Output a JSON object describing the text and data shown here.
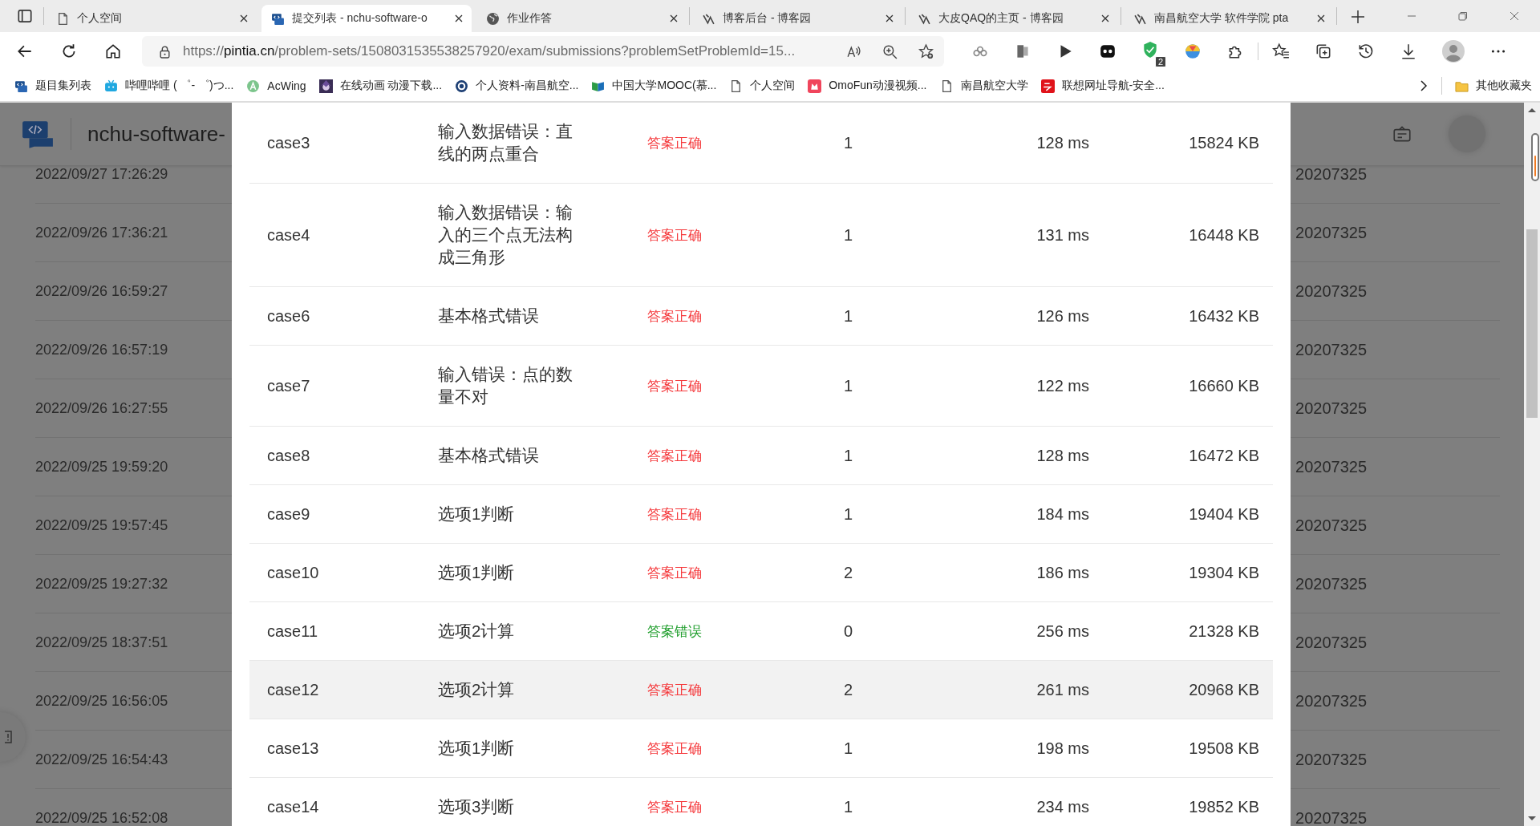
{
  "tabs": [
    {
      "title": "个人空间",
      "kind": "page",
      "selected": false
    },
    {
      "title": "提交列表 - nchu-software-o",
      "kind": "pta",
      "selected": true
    },
    {
      "title": "作业作答",
      "kind": "globe",
      "selected": false
    },
    {
      "title": "博客后台 - 博客园",
      "kind": "cnblogs",
      "selected": false
    },
    {
      "title": "大皮QAQ的主页 - 博客园",
      "kind": "cnblogs",
      "selected": false
    },
    {
      "title": "南昌航空大学 软件学院 pta",
      "kind": "cnblogs",
      "selected": false
    }
  ],
  "address": {
    "scheme": "https://",
    "host": "pintia.cn",
    "path": "/problem-sets/1508031535538257920/exam/submissions?problemSetProblemId=15..."
  },
  "extension_badge": "2",
  "bookmarks": [
    {
      "label": "题目集列表",
      "kind": "pta"
    },
    {
      "label": "哔哩哔哩 ( ゜- ゜)つ...",
      "kind": "tv"
    },
    {
      "label": "AcWing",
      "kind": "acwing"
    },
    {
      "label": "在线动画 动漫下载...",
      "kind": "anime"
    },
    {
      "label": "个人资料-南昌航空...",
      "kind": "seal"
    },
    {
      "label": "中国大学MOOC(慕...",
      "kind": "book"
    },
    {
      "label": "个人空间",
      "kind": "page"
    },
    {
      "label": "OmoFun动漫视频...",
      "kind": "omo"
    },
    {
      "label": "南昌航空大学",
      "kind": "page"
    },
    {
      "label": "联想网址导航-安全...",
      "kind": "lenovo"
    }
  ],
  "other_bookmarks": "其他收藏夹",
  "site_title": "nchu-software-",
  "background_rows": [
    {
      "time": "2022/09/27 17:26:29",
      "user": "20207325"
    },
    {
      "time": "2022/09/26 17:36:21",
      "user": "20207325"
    },
    {
      "time": "2022/09/26 16:59:27",
      "user": "20207325"
    },
    {
      "time": "2022/09/26 16:57:19",
      "user": "20207325"
    },
    {
      "time": "2022/09/26 16:27:55",
      "user": "20207325"
    },
    {
      "time": "2022/09/25 19:59:20",
      "user": "20207325"
    },
    {
      "time": "2022/09/25 19:57:45",
      "user": "20207325"
    },
    {
      "time": "2022/09/25 19:27:32",
      "user": "20207325"
    },
    {
      "time": "2022/09/25 18:37:51",
      "user": "20207325"
    },
    {
      "time": "2022/09/25 16:56:05",
      "user": "20207325"
    },
    {
      "time": "2022/09/25 16:54:43",
      "user": "20207325"
    },
    {
      "time": "2022/09/25 16:52:08",
      "user": "20207325"
    }
  ],
  "cases": [
    {
      "case": "case3",
      "description": "输入数据错误：直线的两点重合",
      "result": "答案正确",
      "color": "#f5383b",
      "score": "1",
      "time": "128 ms",
      "memory": "15824 KB",
      "highlighted": false
    },
    {
      "case": "case4",
      "description": "输入数据错误：输入的三个点无法构成三角形",
      "result": "答案正确",
      "color": "#f5383b",
      "score": "1",
      "time": "131 ms",
      "memory": "16448 KB",
      "highlighted": false
    },
    {
      "case": "case6",
      "description": "基本格式错误",
      "result": "答案正确",
      "color": "#f5383b",
      "score": "1",
      "time": "126 ms",
      "memory": "16432 KB",
      "highlighted": false
    },
    {
      "case": "case7",
      "description": "输入错误：点的数量不对",
      "result": "答案正确",
      "color": "#f5383b",
      "score": "1",
      "time": "122 ms",
      "memory": "16660 KB",
      "highlighted": false
    },
    {
      "case": "case8",
      "description": "基本格式错误",
      "result": "答案正确",
      "color": "#f5383b",
      "score": "1",
      "time": "128 ms",
      "memory": "16472 KB",
      "highlighted": false
    },
    {
      "case": "case9",
      "description": "选项1判断",
      "result": "答案正确",
      "color": "#f5383b",
      "score": "1",
      "time": "184 ms",
      "memory": "19404 KB",
      "highlighted": false
    },
    {
      "case": "case10",
      "description": "选项1判断",
      "result": "答案正确",
      "color": "#f5383b",
      "score": "2",
      "time": "186 ms",
      "memory": "19304 KB",
      "highlighted": false
    },
    {
      "case": "case11",
      "description": "选项2计算",
      "result": "答案错误",
      "color": "#1f9e2c",
      "score": "0",
      "time": "256 ms",
      "memory": "21328 KB",
      "highlighted": false
    },
    {
      "case": "case12",
      "description": "选项2计算",
      "result": "答案正确",
      "color": "#f5383b",
      "score": "2",
      "time": "261 ms",
      "memory": "20968 KB",
      "highlighted": true
    },
    {
      "case": "case13",
      "description": "选项1判断",
      "result": "答案正确",
      "color": "#f5383b",
      "score": "1",
      "time": "198 ms",
      "memory": "19508 KB",
      "highlighted": false
    },
    {
      "case": "case14",
      "description": "选项3判断",
      "result": "答案正确",
      "color": "#f5383b",
      "score": "1",
      "time": "234 ms",
      "memory": "19852 KB",
      "highlighted": false
    }
  ]
}
